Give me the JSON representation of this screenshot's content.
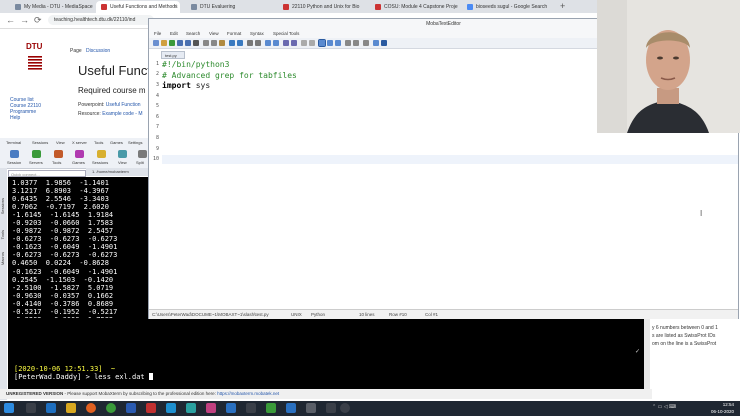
{
  "browser": {
    "tabs": [
      {
        "label": "My Media - DTU - MediaSpace",
        "active": false
      },
      {
        "label": "Useful Functions and Methods",
        "active": true
      },
      {
        "label": "DTU Evaluering",
        "active": false
      },
      {
        "label": "22110 Python and Unix for Bio",
        "active": false
      },
      {
        "label": "COSU: Module 4 Capstone Proje",
        "active": false
      },
      {
        "label": "bioseeds sugul - Google Search",
        "active": false
      }
    ],
    "new_tab": "+",
    "url": "teaching.healthtech.dtu.dk/22110/ind"
  },
  "page": {
    "logo_text": "DTU",
    "page_tab": "Page",
    "discussion_tab": "Discussion",
    "title": "Useful Functio",
    "required_line": "Required course m",
    "powerpoint_label": "Powerpoint:",
    "powerpoint_link": "Useful Function",
    "resource_label": "Resource:",
    "resource_link": "Example code - M",
    "sidebar_links": [
      "Course list",
      "Course 22110",
      "Programme",
      "Help"
    ]
  },
  "mobaxterm": {
    "toolbar": [
      "Terminal",
      "Sessions",
      "View",
      "X server",
      "Tools",
      "Games",
      "Settings",
      "Macros",
      "Help"
    ],
    "buttons": [
      "Session",
      "Servers",
      "Tools",
      "Games",
      "Sessions",
      "View",
      "Split"
    ],
    "quick_connect": "Quick connect...",
    "tab_label": "1. /home/mobaxterm",
    "side_tabs": [
      "Sessions",
      "Tools",
      "Macros"
    ],
    "terminal_lines": [
      "1.0377  1.9856  -1.1401",
      "3.1217  6.8903  -4.3967",
      "0.6435  2.5546  -3.3403",
      "0.7062  -0.7197  2.6020",
      "-1.6145  -1.6145  1.9184",
      "-0.9203  -0.0660  1.7583",
      "-0.9872  -0.9872  2.5457",
      "-0.6273  -0.6273  -0.6273",
      "-0.1623  -0.6049  -1.4901",
      "-0.6273  -0.6273  -0.6273",
      "0.4650  0.0224  -0.8628",
      "-0.1623  -0.6049  -1.4901",
      "0.2545  -1.1503  -0.1420",
      "-2.5100  -1.5827  5.0719",
      "-0.9630  -0.0357  0.1662",
      "-0.4140  -0.3786  0.8689",
      "-0.5217  -0.1952  -0.5217",
      "-0.9203  -0.0660  1.7583",
      "-0.3852  -0.4177  0.0305",
      "-1.9650  1.0131  -0.6821"
    ],
    "prompt_time": "[2020-10-06 12:51.33]  ~",
    "prompt_command": "[PeterWad.Daddy] > less exl.dat ",
    "status_unregistered": "UNREGISTERED VERSION",
    "status_message": "-  Please support MobaXterm by subscribing to the professional edition here:",
    "status_link": "https://mobaxterm.mobatek.net"
  },
  "right_text": [
    "y 6 numbers between 0 and 1",
    "s are listed as SwissProt IDs",
    "om on the line is a SwissProt"
  ],
  "editor": {
    "title": "MobaTextEditor",
    "menu": [
      "File",
      "Edit",
      "Search",
      "View",
      "Format",
      "Syntax",
      "Special Tools"
    ],
    "file_tab": "test.py",
    "line_numbers": [
      "1",
      "2",
      "3",
      "4",
      "5",
      "6",
      "7",
      "8",
      "9",
      "10"
    ],
    "code": {
      "line1": "#!/bin/python3",
      "line2": "# Advanced grep for tabfiles",
      "line3_kw": "import",
      "line3_rest": " sys"
    },
    "status": {
      "path": "C:\\Users\\PeterWad\\DOCUME~1\\MOBAXT~1\\slash\\test.py",
      "eol": "UNIX",
      "syntax": "Python",
      "lines": "10 lines",
      "row": "Row #10",
      "col": "Col #1"
    }
  },
  "taskbar": {
    "time": "12:54",
    "date": "06-10-2020"
  }
}
